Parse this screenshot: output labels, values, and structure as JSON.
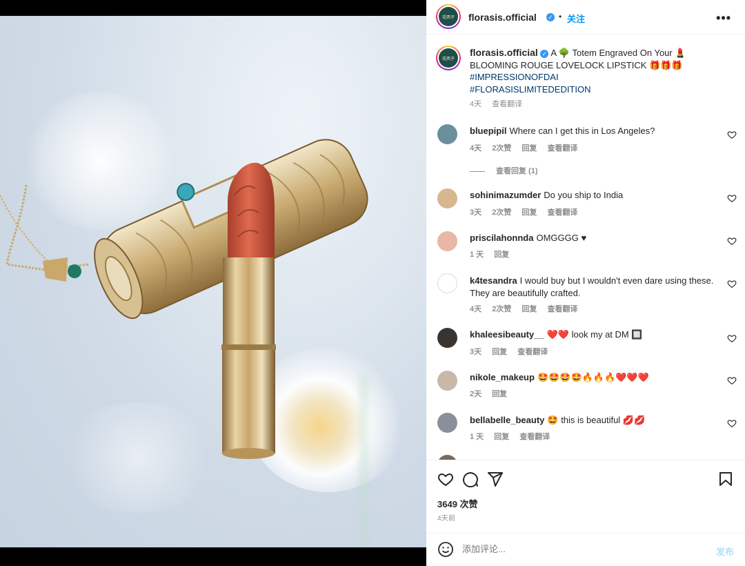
{
  "post": {
    "account": "florasis.official",
    "follow_label": "关注",
    "more_label": "•••",
    "dot": "•",
    "avatar_text": "花西子",
    "caption": {
      "username": "florasis.official",
      "text": "A 🌳 Totem Engraved On Your 💄 BLOOMING ROUGE LOVELOCK LIPSTICK 🎁🎁🎁",
      "hashtags": [
        "#IMPRESSIONOFDAI",
        "#FLORASISLIMITEDEDITION"
      ],
      "time": "4天",
      "translate": "查看翻译"
    },
    "comments": [
      {
        "user": "bluepipil",
        "text": "Where can I get this in Los Angeles?",
        "time": "4天",
        "likes": "2次赞",
        "reply": "回复",
        "translate": "查看翻译",
        "view_replies": "查看回复 (1)",
        "avatar_color": "#6b8f9c"
      },
      {
        "user": "sohinimazumder",
        "text": "Do you ship to India",
        "time": "3天",
        "likes": "2次赞",
        "reply": "回复",
        "translate": "查看翻译",
        "avatar_color": "#d6b78f"
      },
      {
        "user": "priscilahonnda",
        "text": "OMGGGG ♥",
        "time": "1 天",
        "reply": "回复",
        "avatar_color": "#e8b7a6"
      },
      {
        "user": "k4tesandra",
        "text": "I would buy but I wouldn't even dare using these. They are beautifully crafted.",
        "time": "4天",
        "likes": "2次赞",
        "reply": "回复",
        "translate": "查看翻译",
        "avatar_color": "#dbdbdb"
      },
      {
        "user": "khaleesibeauty__",
        "text": "❤️❤️ look my at DM 🔲",
        "time": "3天",
        "reply": "回复",
        "translate": "查看翻译",
        "avatar_color": "#3a3430"
      },
      {
        "user": "nikole_makeup",
        "text": "🤩🤩🤩🤩🔥🔥🔥❤️❤️❤️",
        "time": "2天",
        "reply": "回复",
        "avatar_color": "#c9b8a8"
      },
      {
        "user": "bellabelle_beauty",
        "text": "🤩 this is beautiful 💋💋",
        "time": "1 天",
        "reply": "回复",
        "translate": "查看翻译",
        "avatar_color": "#8a8f9a"
      }
    ],
    "likes_count": "3649 次赞",
    "posted_ago": "4天前",
    "comment_placeholder": "添加评论...",
    "post_label": "发布",
    "icons": [
      "heart-icon",
      "comment-icon",
      "share-icon",
      "bookmark-icon",
      "emoji-icon",
      "verified-badge-icon"
    ],
    "colors": {
      "link": "#0095f6",
      "hashtag": "#00376b",
      "muted": "#8e8e8e",
      "text": "#262626"
    }
  }
}
